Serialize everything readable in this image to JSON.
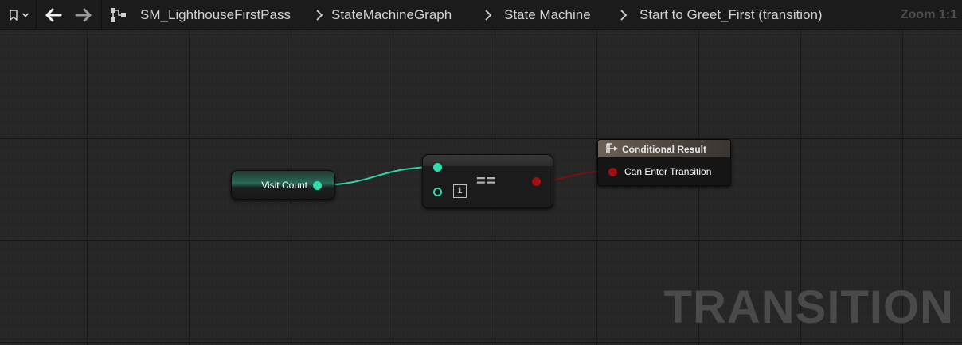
{
  "toolbar": {
    "breadcrumbs": [
      "SM_LighthouseFirstPass",
      "StateMachineGraph",
      "State Machine",
      "Start to Greet_First (transition)"
    ],
    "zoom_label": "Zoom 1:1"
  },
  "graph": {
    "variable_node": {
      "label": "Visit Count"
    },
    "equals_node": {
      "operator": "==",
      "input_b_value": "1"
    },
    "result_node": {
      "title": "Conditional Result",
      "pin_label": "Can Enter Transition"
    },
    "watermark": "TRANSITION"
  },
  "colors": {
    "integer_pin": "#2fdcb0",
    "bool_pin": "#a01010",
    "canvas_bg": "#262626",
    "toolbar_bg": "#1b1b1b"
  }
}
